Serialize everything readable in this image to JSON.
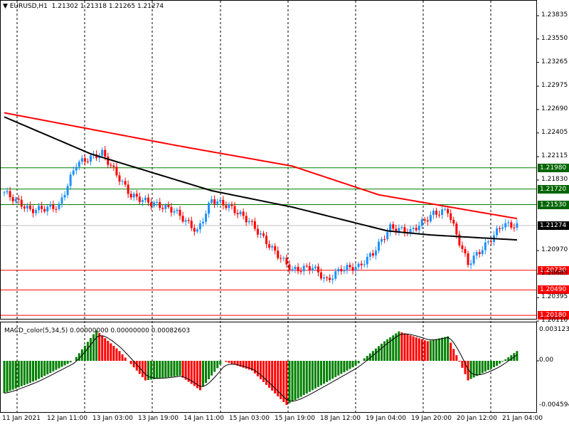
{
  "header": {
    "symbol": "EURUSD,H1",
    "open": "1.21302",
    "high": "1.21318",
    "low": "1.21265",
    "close": "1.21274"
  },
  "price_axis": [
    "1.23835",
    "1.23550",
    "1.23265",
    "1.22975",
    "1.22690",
    "1.22405",
    "1.22115",
    "1.21830",
    "1.20970",
    "1.20685",
    "1.20395",
    "1.20110"
  ],
  "levels": [
    {
      "value": "1.21980",
      "color": "#006400",
      "line": "#008000"
    },
    {
      "value": "1.21720",
      "color": "#006400",
      "line": "#008000"
    },
    {
      "value": "1.21530",
      "color": "#006400",
      "line": "#008000"
    },
    {
      "value": "1.20730",
      "color": "#ff0000",
      "line": "#ff0000"
    },
    {
      "value": "1.20490",
      "color": "#ff0000",
      "line": "#ff0000"
    },
    {
      "value": "1.20180",
      "color": "#ff0000",
      "line": "#ff0000"
    }
  ],
  "current_price": {
    "value": "1.21274",
    "color": "#000000"
  },
  "macd": {
    "title": "MACD_color(5,34,5) 0.00000000 0.00000000 0.00082603",
    "axis": [
      "0.0031235",
      "0.00",
      "-0.004594"
    ]
  },
  "time_axis": [
    "11 Jan 2021",
    "12 Jan 11:00",
    "13 Jan 03:00",
    "13 Jan 19:00",
    "14 Jan 11:00",
    "15 Jan 03:00",
    "15 Jan 19:00",
    "18 Jan 12:00",
    "19 Jan 04:00",
    "19 Jan 20:00",
    "20 Jan 12:00",
    "21 Jan 04:00"
  ],
  "chart_data": {
    "type": "candlestick",
    "symbol": "EURUSD",
    "timeframe": "H1",
    "close_path": [
      [
        0,
        1.2168
      ],
      [
        9,
        1.2146
      ],
      [
        19,
        1.2151
      ],
      [
        25,
        1.2203
      ],
      [
        34,
        1.2216
      ],
      [
        39,
        1.219
      ],
      [
        44,
        1.2164
      ],
      [
        51,
        1.2155
      ],
      [
        59,
        1.2146
      ],
      [
        67,
        1.212
      ],
      [
        72,
        1.2159
      ],
      [
        78,
        1.2151
      ],
      [
        85,
        1.2133
      ],
      [
        93,
        1.2099
      ],
      [
        100,
        1.2073
      ],
      [
        107,
        1.2077
      ],
      [
        112,
        1.206
      ],
      [
        117,
        1.2075
      ],
      [
        123,
        1.2077
      ],
      [
        128,
        1.2094
      ],
      [
        134,
        1.2125
      ],
      [
        141,
        1.212
      ],
      [
        149,
        1.2142
      ],
      [
        154,
        1.2146
      ],
      [
        157,
        1.2116
      ],
      [
        161,
        1.2081
      ],
      [
        168,
        1.2107
      ],
      [
        173,
        1.2129
      ],
      [
        178,
        1.2127
      ]
    ],
    "ma_red": [
      [
        0,
        1.2265
      ],
      [
        60,
        1.2225
      ],
      [
        100,
        1.22
      ],
      [
        130,
        1.2165
      ],
      [
        178,
        1.2136
      ]
    ],
    "ma_black": [
      [
        0,
        1.226
      ],
      [
        30,
        1.2215
      ],
      [
        72,
        1.217
      ],
      [
        100,
        1.215
      ],
      [
        133,
        1.2121
      ],
      [
        148,
        1.2116
      ],
      [
        178,
        1.211
      ]
    ],
    "macd_hist": [
      [
        0,
        -0.0033
      ],
      [
        11,
        -0.002
      ],
      [
        24,
        0
      ],
      [
        32,
        0.0031
      ],
      [
        40,
        0.001
      ],
      [
        49,
        -0.002
      ],
      [
        61,
        -0.0015
      ],
      [
        68,
        -0.003
      ],
      [
        76,
        0
      ],
      [
        86,
        -0.001
      ],
      [
        98,
        -0.0045
      ],
      [
        110,
        -0.0025
      ],
      [
        122,
        -0.0005
      ],
      [
        132,
        0.002
      ],
      [
        137,
        0.003
      ],
      [
        147,
        0.002
      ],
      [
        154,
        0.0025
      ],
      [
        161,
        -0.002
      ],
      [
        171,
        -0.0005
      ],
      [
        178,
        0.001
      ]
    ],
    "ylim": [
      1.2011,
      1.23835
    ],
    "macd_ylim": [
      -0.004594,
      0.0031235
    ]
  }
}
